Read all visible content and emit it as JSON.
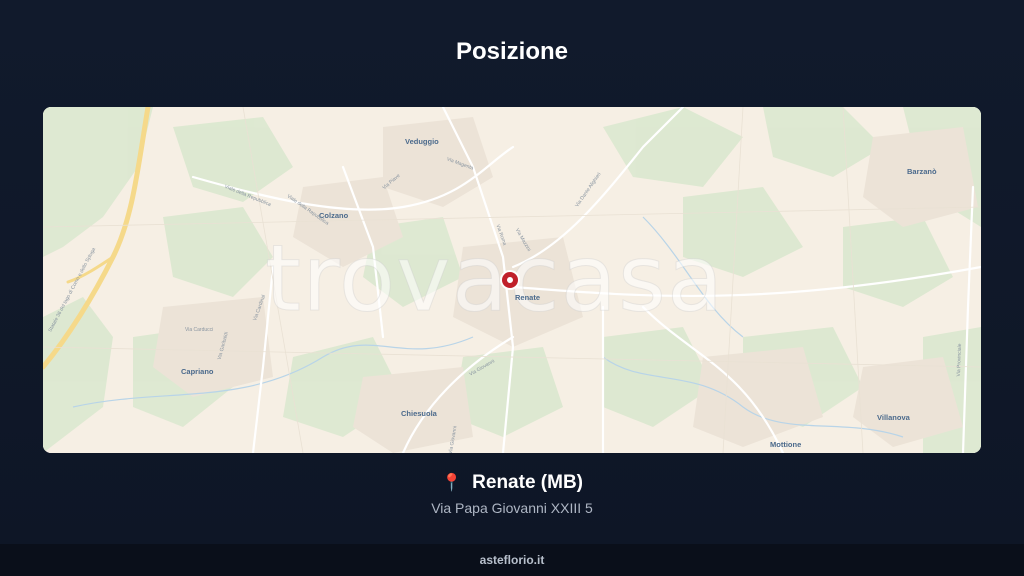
{
  "page": {
    "title": "Posizione"
  },
  "map": {
    "watermark": "trovacasa",
    "places": {
      "veduggio": "Veduggio",
      "colzano": "Colzano",
      "renate": "Renate",
      "barzano": "Barzanò",
      "capriano": "Capriano",
      "chiesuola": "Chiesuola",
      "villanova": "Villanova",
      "mottione": "Mottione"
    },
    "streets": {
      "via_magenta": "Via Magenta",
      "via_piave": "Via Piave",
      "via_repubblica": "Viale della Repubblica",
      "via_repubblica2": "Viale della Repubblica",
      "via_dante": "Via Dante Alighieri",
      "via_roma": "Via Roma",
      "via_mazzini": "Via Mazzini",
      "via_cardinal": "Via Cardinal",
      "via_garibaldi": "Via Garibaldi",
      "via_carducci": "Via Carducci",
      "via_giovanni": "Via Giovanni",
      "via_provinciale": "Via Provinciale",
      "statale": "Statale 36 del lago di Como e dello Spluga",
      "via_bottom": "Via Giovanni"
    }
  },
  "location": {
    "pin_icon": "📍",
    "name": "Renate (MB)",
    "address": "Via Papa Giovanni XXIII 5"
  },
  "footer": {
    "site": "asteflorio.it"
  }
}
